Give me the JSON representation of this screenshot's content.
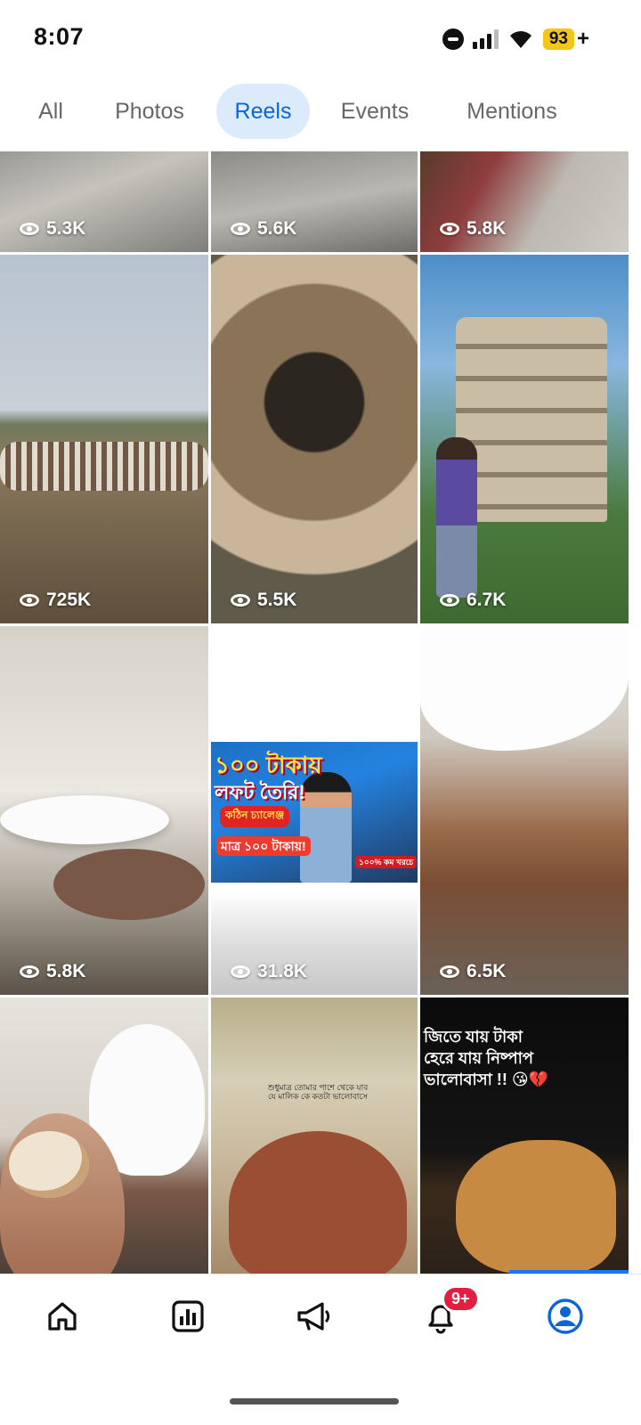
{
  "status_bar": {
    "time": "8:07",
    "battery": "93",
    "battery_suffix": "+",
    "icons": [
      "do-not-disturb-icon",
      "signal-icon",
      "wifi-icon",
      "battery-icon"
    ]
  },
  "tabs": [
    {
      "label": "All",
      "active": false
    },
    {
      "label": "Photos",
      "active": false
    },
    {
      "label": "Reels",
      "active": true
    },
    {
      "label": "Events",
      "active": false
    },
    {
      "label": "Mentions",
      "active": false
    }
  ],
  "reels": [
    {
      "views": "5.3K"
    },
    {
      "views": "5.6K"
    },
    {
      "views": "5.8K"
    },
    {
      "views": "725K"
    },
    {
      "views": "5.5K"
    },
    {
      "views": "6.7K"
    },
    {
      "views": "5.8K"
    },
    {
      "views": "31.8K"
    },
    {
      "views": "6.5K"
    },
    {
      "views": ""
    },
    {
      "views": ""
    },
    {
      "views": ""
    }
  ],
  "thumbnail_text": {
    "line1": "১০০ টাকায়",
    "line2": "লফট তৈরি!",
    "tag": "কঠিন চ্যালেঞ্জ",
    "price": "মাত্র ১০০ টাকায়!",
    "stamp": "১০০% কম খরচে"
  },
  "reel_captions": {
    "reel_11": "শুধুমাত্র তোমার পাশে থেকে যাব যে মালিক কে কতটা ভালোবাসে",
    "reel_12_line1": "জিতে যায় টাকা",
    "reel_12_line2": "হেরে যায় নিষ্পাপ",
    "reel_12_line3": "ভালোবাসা !! 😘💔"
  },
  "bottom_nav": {
    "items": [
      "home-icon",
      "insights-icon",
      "ads-megaphone-icon",
      "notifications-bell-icon",
      "profile-icon"
    ],
    "notification_badge": "9+",
    "active": "profile-icon"
  },
  "colors": {
    "accent": "#0a66d8",
    "tab_active_bg": "#dcebfb",
    "badge": "#e41e3f",
    "battery": "#f5c518"
  }
}
